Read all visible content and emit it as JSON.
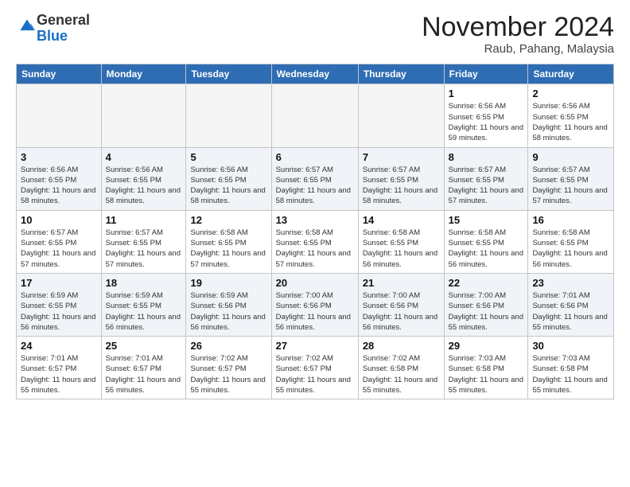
{
  "logo": {
    "general": "General",
    "blue": "Blue"
  },
  "title": "November 2024",
  "location": "Raub, Pahang, Malaysia",
  "weekdays": [
    "Sunday",
    "Monday",
    "Tuesday",
    "Wednesday",
    "Thursday",
    "Friday",
    "Saturday"
  ],
  "weeks": [
    [
      {
        "day": "",
        "info": ""
      },
      {
        "day": "",
        "info": ""
      },
      {
        "day": "",
        "info": ""
      },
      {
        "day": "",
        "info": ""
      },
      {
        "day": "",
        "info": ""
      },
      {
        "day": "1",
        "info": "Sunrise: 6:56 AM\nSunset: 6:55 PM\nDaylight: 11 hours and 59 minutes."
      },
      {
        "day": "2",
        "info": "Sunrise: 6:56 AM\nSunset: 6:55 PM\nDaylight: 11 hours and 58 minutes."
      }
    ],
    [
      {
        "day": "3",
        "info": "Sunrise: 6:56 AM\nSunset: 6:55 PM\nDaylight: 11 hours and 58 minutes."
      },
      {
        "day": "4",
        "info": "Sunrise: 6:56 AM\nSunset: 6:55 PM\nDaylight: 11 hours and 58 minutes."
      },
      {
        "day": "5",
        "info": "Sunrise: 6:56 AM\nSunset: 6:55 PM\nDaylight: 11 hours and 58 minutes."
      },
      {
        "day": "6",
        "info": "Sunrise: 6:57 AM\nSunset: 6:55 PM\nDaylight: 11 hours and 58 minutes."
      },
      {
        "day": "7",
        "info": "Sunrise: 6:57 AM\nSunset: 6:55 PM\nDaylight: 11 hours and 58 minutes."
      },
      {
        "day": "8",
        "info": "Sunrise: 6:57 AM\nSunset: 6:55 PM\nDaylight: 11 hours and 57 minutes."
      },
      {
        "day": "9",
        "info": "Sunrise: 6:57 AM\nSunset: 6:55 PM\nDaylight: 11 hours and 57 minutes."
      }
    ],
    [
      {
        "day": "10",
        "info": "Sunrise: 6:57 AM\nSunset: 6:55 PM\nDaylight: 11 hours and 57 minutes."
      },
      {
        "day": "11",
        "info": "Sunrise: 6:57 AM\nSunset: 6:55 PM\nDaylight: 11 hours and 57 minutes."
      },
      {
        "day": "12",
        "info": "Sunrise: 6:58 AM\nSunset: 6:55 PM\nDaylight: 11 hours and 57 minutes."
      },
      {
        "day": "13",
        "info": "Sunrise: 6:58 AM\nSunset: 6:55 PM\nDaylight: 11 hours and 57 minutes."
      },
      {
        "day": "14",
        "info": "Sunrise: 6:58 AM\nSunset: 6:55 PM\nDaylight: 11 hours and 56 minutes."
      },
      {
        "day": "15",
        "info": "Sunrise: 6:58 AM\nSunset: 6:55 PM\nDaylight: 11 hours and 56 minutes."
      },
      {
        "day": "16",
        "info": "Sunrise: 6:58 AM\nSunset: 6:55 PM\nDaylight: 11 hours and 56 minutes."
      }
    ],
    [
      {
        "day": "17",
        "info": "Sunrise: 6:59 AM\nSunset: 6:55 PM\nDaylight: 11 hours and 56 minutes."
      },
      {
        "day": "18",
        "info": "Sunrise: 6:59 AM\nSunset: 6:55 PM\nDaylight: 11 hours and 56 minutes."
      },
      {
        "day": "19",
        "info": "Sunrise: 6:59 AM\nSunset: 6:56 PM\nDaylight: 11 hours and 56 minutes."
      },
      {
        "day": "20",
        "info": "Sunrise: 7:00 AM\nSunset: 6:56 PM\nDaylight: 11 hours and 56 minutes."
      },
      {
        "day": "21",
        "info": "Sunrise: 7:00 AM\nSunset: 6:56 PM\nDaylight: 11 hours and 56 minutes."
      },
      {
        "day": "22",
        "info": "Sunrise: 7:00 AM\nSunset: 6:56 PM\nDaylight: 11 hours and 55 minutes."
      },
      {
        "day": "23",
        "info": "Sunrise: 7:01 AM\nSunset: 6:56 PM\nDaylight: 11 hours and 55 minutes."
      }
    ],
    [
      {
        "day": "24",
        "info": "Sunrise: 7:01 AM\nSunset: 6:57 PM\nDaylight: 11 hours and 55 minutes."
      },
      {
        "day": "25",
        "info": "Sunrise: 7:01 AM\nSunset: 6:57 PM\nDaylight: 11 hours and 55 minutes."
      },
      {
        "day": "26",
        "info": "Sunrise: 7:02 AM\nSunset: 6:57 PM\nDaylight: 11 hours and 55 minutes."
      },
      {
        "day": "27",
        "info": "Sunrise: 7:02 AM\nSunset: 6:57 PM\nDaylight: 11 hours and 55 minutes."
      },
      {
        "day": "28",
        "info": "Sunrise: 7:02 AM\nSunset: 6:58 PM\nDaylight: 11 hours and 55 minutes."
      },
      {
        "day": "29",
        "info": "Sunrise: 7:03 AM\nSunset: 6:58 PM\nDaylight: 11 hours and 55 minutes."
      },
      {
        "day": "30",
        "info": "Sunrise: 7:03 AM\nSunset: 6:58 PM\nDaylight: 11 hours and 55 minutes."
      }
    ]
  ]
}
